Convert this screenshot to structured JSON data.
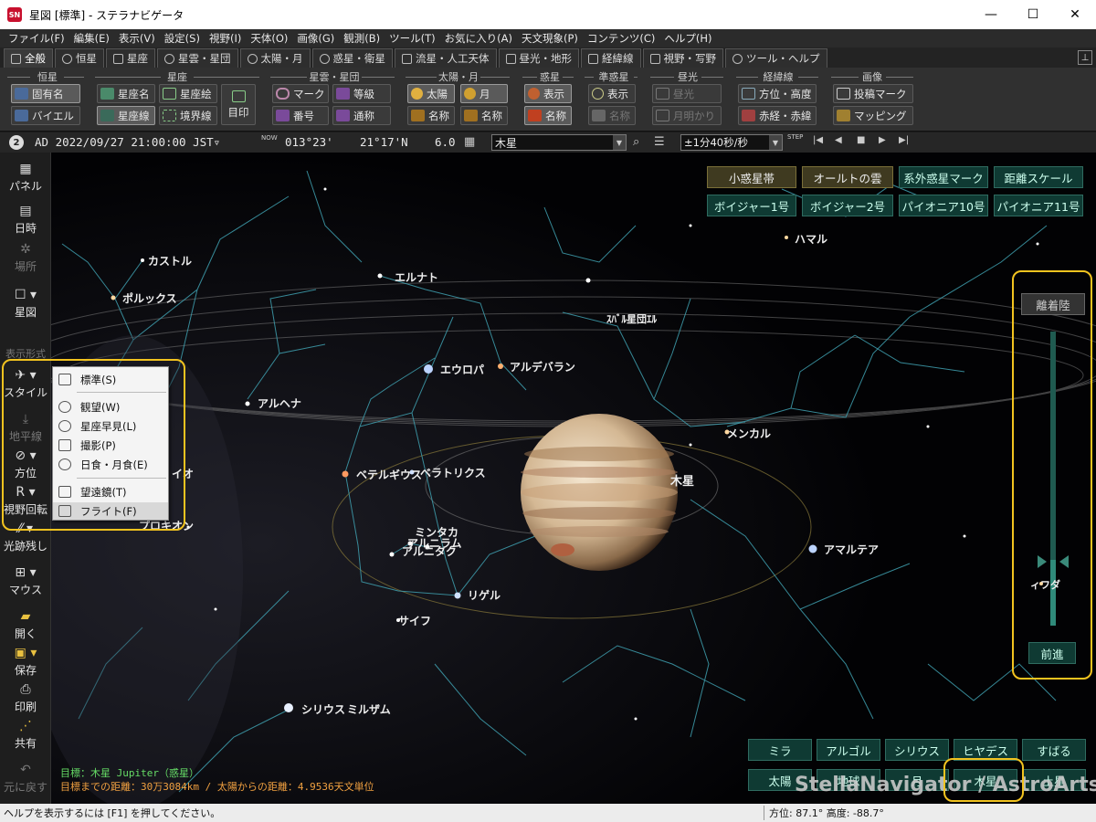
{
  "window": {
    "app_icon": "SN",
    "title": "星図 [標準] - ステラナビゲータ",
    "minimize": "—",
    "maximize": "☐",
    "close": "✕"
  },
  "menu": [
    "ファイル(F)",
    "編集(E)",
    "表示(V)",
    "設定(S)",
    "視野(I)",
    "天体(O)",
    "画像(G)",
    "観測(B)",
    "ツール(T)",
    "お気に入り(A)",
    "天文現象(P)",
    "コンテンツ(C)",
    "ヘルプ(H)"
  ],
  "tabs": [
    "全般",
    "恒星",
    "星座",
    "星雲・星団",
    "太陽・月",
    "惑星・衛星",
    "流星・人工天体",
    "昼光・地形",
    "経緯線",
    "視野・写野",
    "ツール・ヘルプ"
  ],
  "ribbon": {
    "groups": {
      "stars": "恒星",
      "constellations": "星座",
      "nebulae": "星雲・星団",
      "sun_moon": "太陽・月",
      "planets": "惑星",
      "dwarf": "準惑星",
      "daylight": "昼光",
      "grid": "経緯線",
      "image": "画像"
    },
    "proper_name": "固有名",
    "bayer": "バイエル",
    "const_name": "星座名",
    "const_art": "星座絵",
    "const_line": "星座線",
    "boundary": "境界線",
    "landmark": "目印",
    "mark": "マーク",
    "magnitude": "等級",
    "number": "番号",
    "common_name": "通称",
    "sun": "太陽",
    "moon": "月",
    "sun_name": "名称",
    "moon_name": "名称",
    "planet_show": "表示",
    "planet_name": "名称",
    "dwarf_show": "表示",
    "dwarf_name": "名称",
    "daylight": "昼光",
    "moonlight": "月明かり",
    "azalt": "方位・高度",
    "radec": "赤経・赤緯",
    "post_mark": "投稿マーク",
    "mapping": "マッピング"
  },
  "timebar": {
    "badge": "2",
    "datetime": "AD 2022/09/27 21:00:00 JST▿",
    "now_icon": "NOW",
    "longitude": "013°23'",
    "latitude": "21°17'N",
    "zoom": "6.0",
    "target": "木星",
    "step": "±1分40秒/秒",
    "step_icon": "STEP"
  },
  "left_toolbar": {
    "panel": "パネル",
    "datetime": "日時",
    "place": "場所",
    "chart": "星図",
    "display_style": "表示形式",
    "style": "スタイル",
    "horizon": "地平線",
    "direction": "方位",
    "rotate": "視野回転",
    "trail": "光跡残し",
    "mouse": "マウス",
    "open": "開く",
    "save": "保存",
    "print": "印刷",
    "share": "共有",
    "undo": "元に戻す"
  },
  "popup": {
    "items": [
      "標準(S)",
      "観望(W)",
      "星座早見(L)",
      "撮影(P)",
      "日食・月食(E)",
      "望遠鏡(T)",
      "フライト(F)"
    ]
  },
  "sky": {
    "top_buttons": [
      "小惑星帯",
      "オールトの雲",
      "系外惑星マーク",
      "距離スケール",
      "ボイジャー1号",
      "ボイジャー2号",
      "パイオニア10号",
      "パイオニア11号"
    ],
    "flight_panel": {
      "takeoff": "離着陸",
      "forward": "前進",
      "side_label": "ィフダ"
    },
    "bottom_buttons": [
      "ミラ",
      "アルゴル",
      "シリウス",
      "ヒヤデス",
      "すばる",
      "太陽",
      "地球",
      "月",
      "木星",
      "土星"
    ],
    "watermark": "StellaNavigator / AstroArts",
    "labels": {
      "castor": "カストル",
      "pollux": "ポルックス",
      "elnath": "エルナト",
      "hamal": "ハマル",
      "overlap": "ｽﾊﾞﾙ星団ｴﾙ",
      "europa": "エウロパ",
      "aldebaran": "アルデバラン",
      "alhena": "アルヘナ",
      "menkar": "メンカル",
      "jupiter": "木星",
      "betelgeuse": "ベテルギウス",
      "bellatrix": "ベラトリクス",
      "io": "イオ",
      "mintaka": "ミンタカ",
      "alnilam": "アルニラム",
      "alnitak": "アルニタク",
      "amalthea": "アマルテア",
      "rigel": "リゲル",
      "saiph": "サイフ",
      "sirius": "シリウス",
      "mirzam": "ミルザム",
      "procyon": "プロキオン"
    },
    "info_target": "目標：木星 Jupiter（惑星）",
    "info_distance": "目標までの距離：30万3084km / 太陽からの距離：4.9536天文単位"
  },
  "statusbar": {
    "help": "ヘルプを表示するには [F1] を押してください。",
    "coords": "方位:  87.1°  高度: -88.7°"
  },
  "colors": {
    "highlight": "#f2c31f",
    "sky_button": "#0f3a33",
    "constellation_line": "#3fa0b0",
    "info_green": "#66dd66",
    "info_orange": "#f0a040"
  }
}
